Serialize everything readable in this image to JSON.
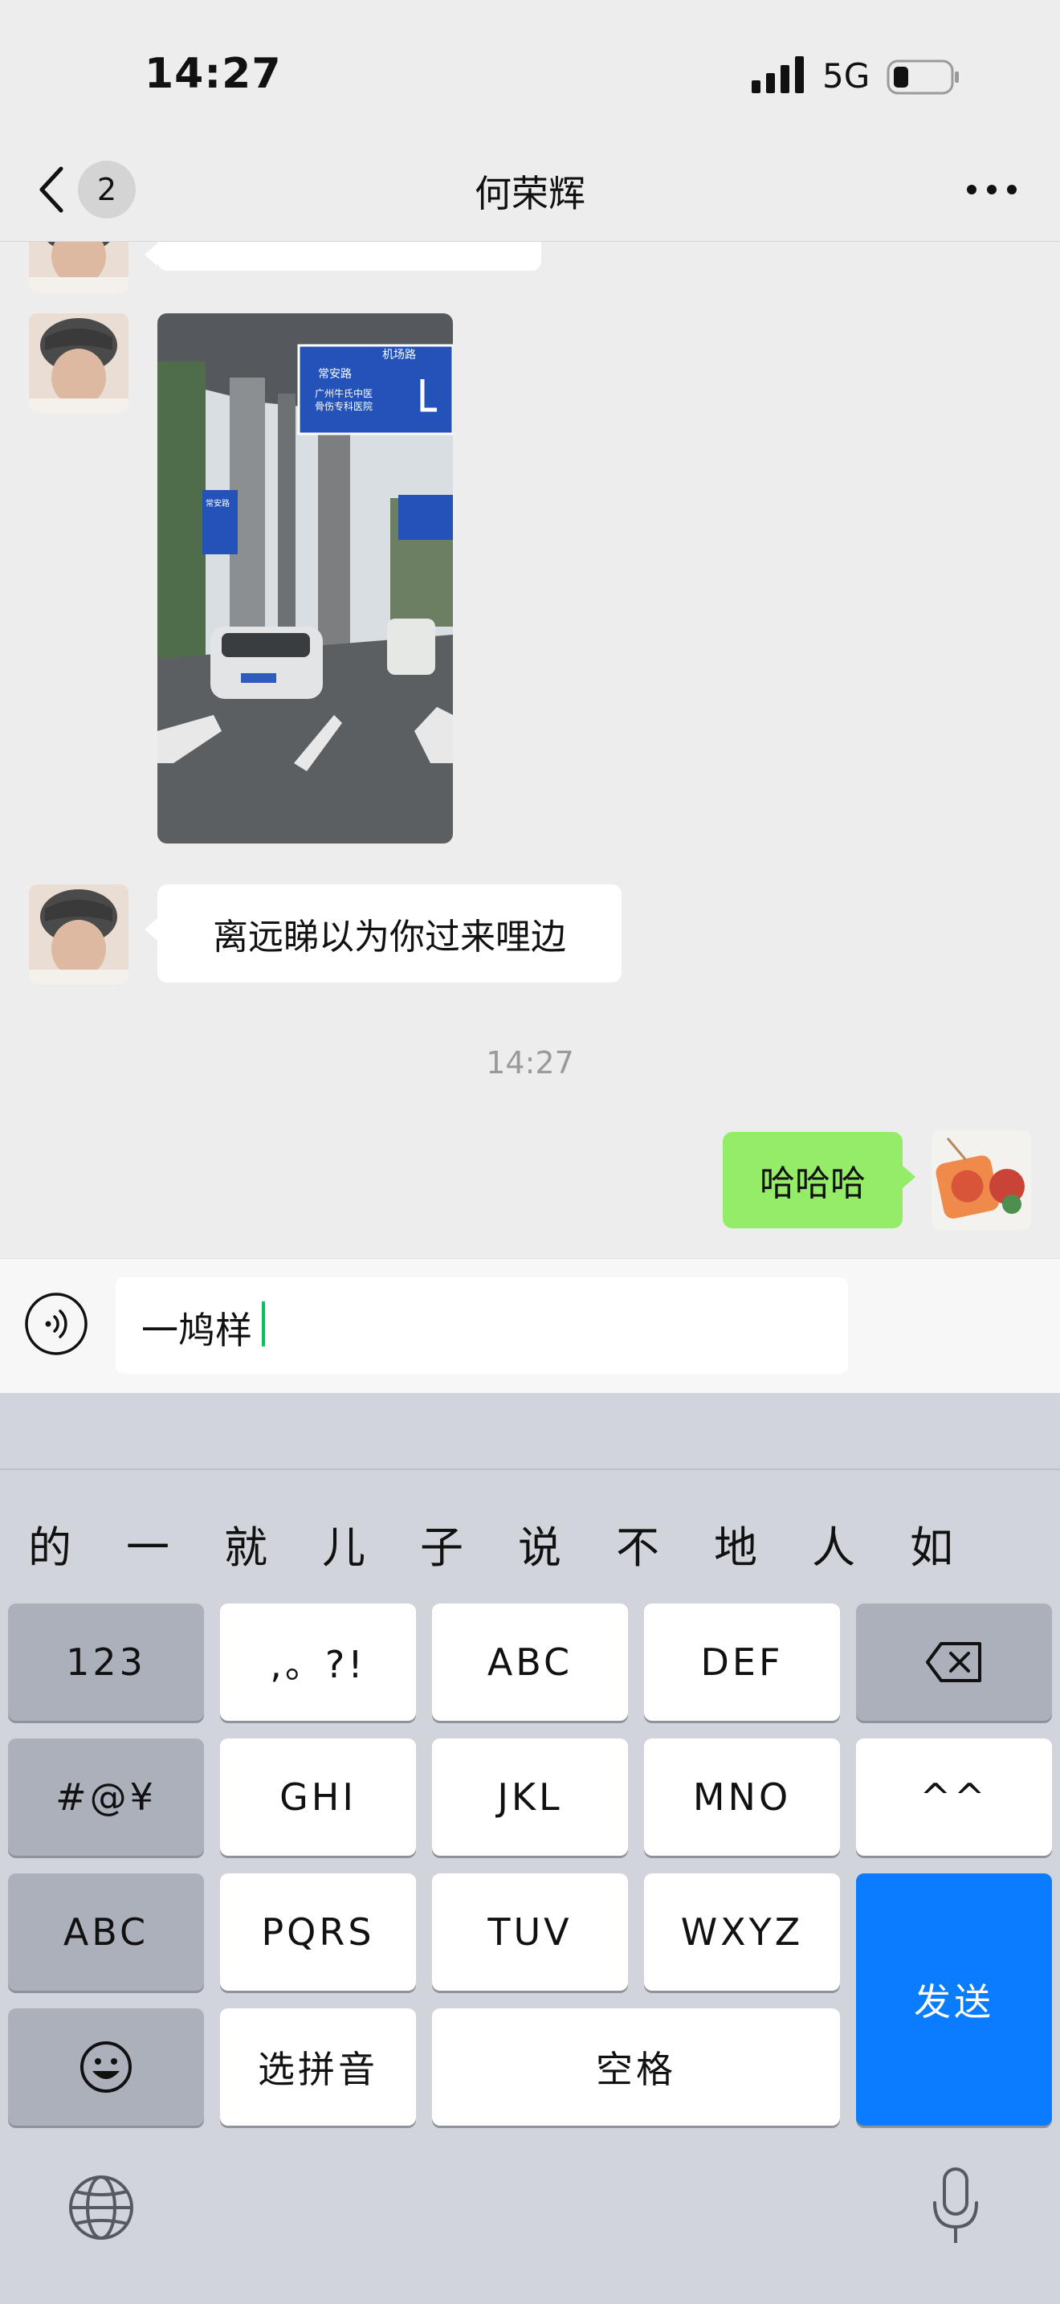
{
  "status_bar": {
    "time": "14:27",
    "network": "5G"
  },
  "nav": {
    "unread_count": "2",
    "title": "何荣辉"
  },
  "chat": {
    "messages": [
      {
        "from": "contact",
        "type": "text",
        "text": ""
      },
      {
        "from": "contact",
        "type": "image"
      },
      {
        "from": "contact",
        "type": "text",
        "text": "离远睇以为你过来哩边"
      },
      {
        "from": "system",
        "type": "timestamp",
        "text": "14:27"
      },
      {
        "from": "me",
        "type": "text",
        "text": "哈哈哈"
      }
    ],
    "photo_signs": {
      "big_sign_street": "常安路",
      "big_sign_top": "机场路",
      "big_sign_line1": "广州牛氏中医",
      "big_sign_line2": "骨伤专科医院",
      "small_sign": "常安路"
    }
  },
  "input": {
    "value": "一鸠样"
  },
  "keyboard": {
    "candidates": [
      "的",
      "一",
      "就",
      "儿",
      "子",
      "说",
      "不",
      "地",
      "人",
      "如"
    ],
    "rows": [
      [
        "123",
        ",。?!",
        "ABC",
        "DEF",
        "delete"
      ],
      [
        "#@¥",
        "GHI",
        "JKL",
        "MNO",
        "^^"
      ],
      [
        "ABC",
        "PQRS",
        "TUV",
        "WXYZ"
      ],
      [
        "emoji",
        "选拼音",
        "空格"
      ]
    ],
    "send_label": "发送",
    "icons": [
      "globe-icon",
      "microphone-icon",
      "emoji-icon",
      "delete-icon"
    ]
  },
  "colors": {
    "background": "#EDEDED",
    "incoming_bubble": "#FFFFFF",
    "outgoing_bubble": "#95EC69",
    "send_key": "#0A7CFF",
    "caret": "#07C160"
  }
}
